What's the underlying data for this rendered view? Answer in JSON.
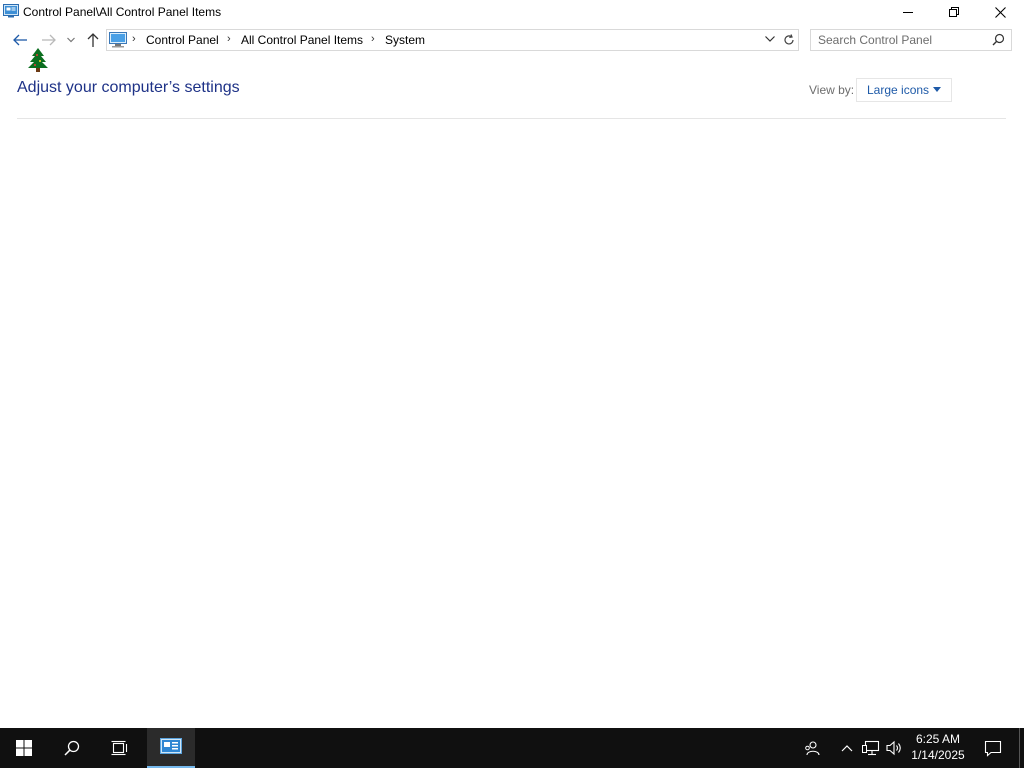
{
  "window": {
    "title": "Control Panel\\All Control Panel Items",
    "controls": [
      "minimize",
      "restore",
      "close"
    ]
  },
  "nav": {
    "breadcrumbs": [
      "Control Panel",
      "All Control Panel Items",
      "System"
    ],
    "search_placeholder": "Search Control Panel"
  },
  "content": {
    "title": "Adjust your computer’s settings",
    "view_by_label": "View by:",
    "view_by_value": "Large icons"
  },
  "taskbar": {
    "time": "6:25 AM",
    "date": "1/14/2025"
  },
  "colors": {
    "title_blue": "#1e3287",
    "link_blue": "#1e5aa8",
    "taskbar_bg": "#101010",
    "taskbar_active": "#76b9ed"
  }
}
